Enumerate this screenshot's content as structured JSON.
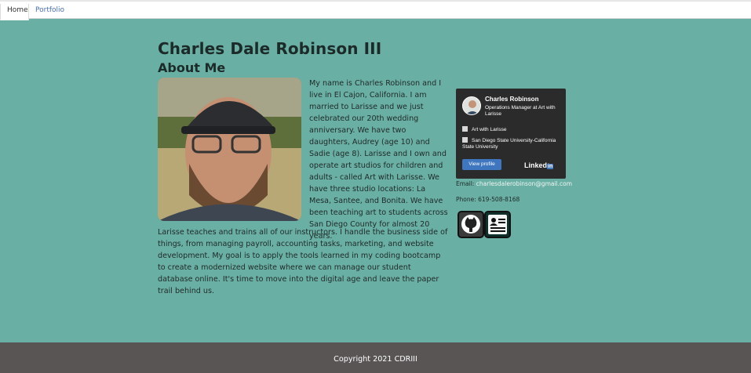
{
  "nav": {
    "tabs": [
      {
        "label": "Home",
        "active": true
      },
      {
        "label": "Portfolio",
        "active": false
      }
    ]
  },
  "header": {
    "name": "Charles Dale Robinson III",
    "section_title": "About Me"
  },
  "bio": {
    "paragraph_1": "My name is Charles Robinson and I live in El Cajon, California. I am married to Larisse and we just celebrated our 20th wedding anniversary. We have two daughters, Audrey (age 10) and Sadie (age 8). Larisse and I own and operate art studios for children and adults - called Art with Larisse. We have three studio locations: La Mesa, Santee, and Bonita. We have been teaching art to students across San Diego County for almost 20 years.",
    "paragraph_2": "Larisse teaches and trains all of our instructors. I handle the business side of things, from managing payroll, accounting tasks, marketing, and website development. My goal is to apply the tools learned in my coding bootcamp to create a modernized website where we can manage our student database online. It's time to move into the digital age and leave the paper trail behind us."
  },
  "linkedin_badge": {
    "name": "Charles Robinson",
    "title": "Operations Manager at Art with Larisse",
    "company": "Art with Larisse",
    "school": "San Diego State University-California State University",
    "button_label": "View profile",
    "logo_text": "Linked",
    "logo_in": "in"
  },
  "contact": {
    "email_label": "Email:",
    "email": "charlesdalerobinson@gmail.com",
    "phone": "Phone: 619-508-8168"
  },
  "icons": {
    "github": "github-icon",
    "resume": "resume-icon"
  },
  "colors": {
    "background": "#6aafa4",
    "footer": "#595555",
    "linkedin_blue": "#3e77c0"
  },
  "footer": {
    "copyright": "Copyright 2021 CDRIII"
  }
}
